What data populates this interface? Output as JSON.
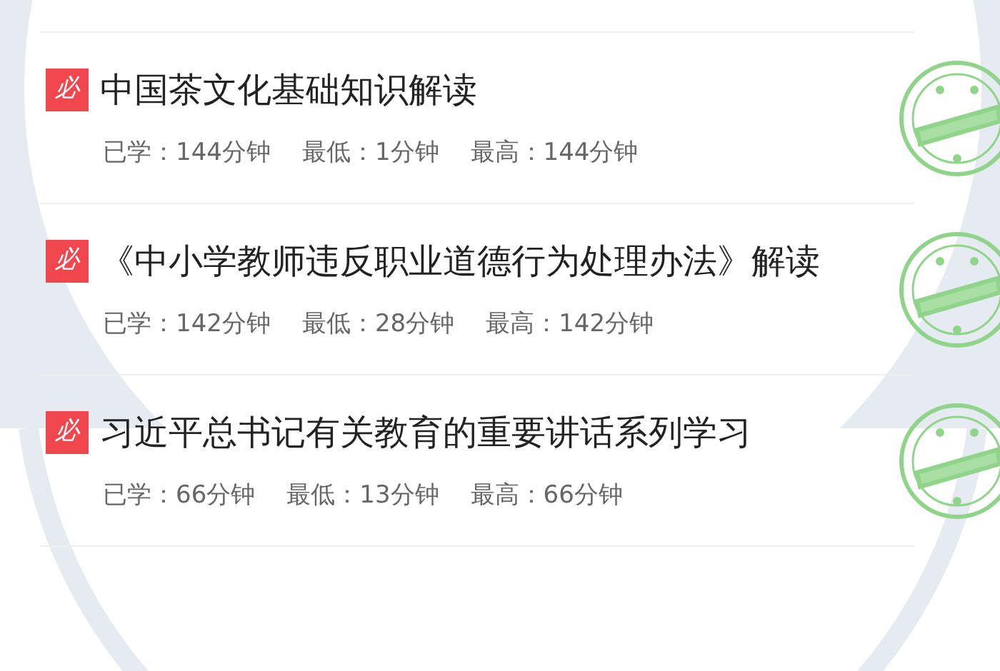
{
  "courses": [
    {
      "badge": "必",
      "title": "中国茶文化基础知识解读",
      "studied": "已学：144分钟",
      "lowest": "最低：1分钟",
      "highest": "最高：144分钟",
      "completed": true
    },
    {
      "badge": "必",
      "title": "《中小学教师违反职业道德行为处理办法》解读",
      "studied": "已学：142分钟",
      "lowest": "最低：28分钟",
      "highest": "最高：142分钟",
      "completed": true
    },
    {
      "badge": "必",
      "title": "习近平总书记有关教育的重要讲话系列学习",
      "studied": "已学：66分钟",
      "lowest": "最低：13分钟",
      "highest": "最高：66分钟",
      "completed": true
    }
  ]
}
